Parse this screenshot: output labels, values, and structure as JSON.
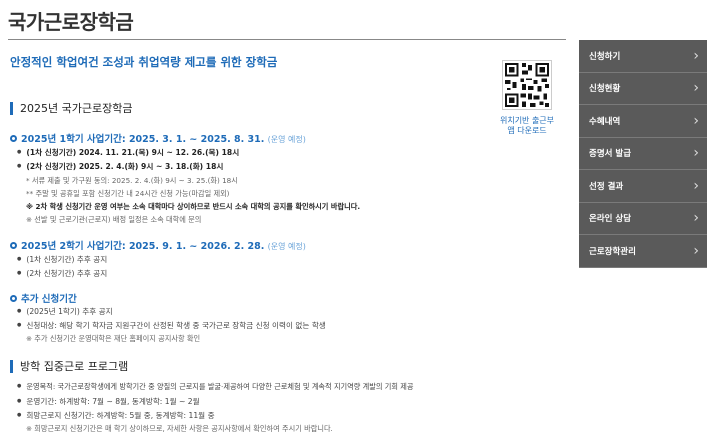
{
  "page": {
    "title": "국가근로장학금",
    "subtitle": "안정적인 학업여건 조성과 취업역량 제고를 위한 장학금"
  },
  "qr": {
    "label_line1": "위치기반 출근부",
    "label_line2": "앱 다운로드"
  },
  "section1": {
    "heading": "2025년 국가근로장학금",
    "period1": {
      "title": "2025년 1학기 사업기간: 2025. 3. 1. ~ 2025. 8. 31.",
      "note": "(운영 예정)",
      "lines": [
        "(1차 신청기간) 2024. 11. 21.(목) 9시 ~ 12. 26.(목) 18시",
        "(2차 신청기간) 2025. 2. 4.(화) 9시 ~ 3. 18.(화) 18시",
        "* 서류 제출 및 가구원 동의: 2025. 2. 4.(화) 9시 ~ 3. 25.(화) 18시",
        "** 주말 및 공휴일 포함 신청기간 내 24시간 신청 가능(마감일 제외)",
        "※ 2차 학생 신청기간 운영 여부는 소속 대학마다 상이하므로 반드시 소속 대학의 공지를 확인하시기 바랍니다.",
        "※ 선발 및 근로기관(근로지) 배정 일정은 소속 대학에 문의"
      ]
    },
    "period2": {
      "title": "2025년 2학기 사업기간: 2025. 9. 1. ~ 2026. 2. 28.",
      "note": "(운영 예정)",
      "lines": [
        "(1차 신청기간) 추후 공지",
        "(2차 신청기간) 추후 공지"
      ]
    },
    "extra": {
      "title": "추가 신청기간",
      "lines": [
        "(2025년 1학기) 추후 공지",
        "신청대상: 해당 학기 학자금 지원구간이 산정된 학생 중 국가근로 장학금 신청 이력이 없는 학생",
        "※ 추가 신청기간 운영대학은 재단 홈페이지 공지사항 확인"
      ]
    }
  },
  "section2": {
    "heading": "방학 집중근로 프로그램",
    "lines": [
      "운영목적: 국가근로장학생에게 방학기간 중 양질의 근로지를 발굴·제공하여 다양한 근로체험 및 계속적 지기역량 계발의 기회 제공",
      "운영기간: 하계방학: 7월 ~ 8월, 동계방학: 1월 ~ 2월",
      "희망근로지 신청기간: 하계방학: 5월 중, 동계방학: 11월 중",
      "※ 희망근로지 신청기간은 매 학기 상이하므로, 자세한 사항은 공지사항에서 확인하여 주시기 바랍니다."
    ]
  },
  "side_menu": [
    "신청하기",
    "신청현황",
    "수혜내역",
    "증명서 발급",
    "선정 결과",
    "온라인 상담",
    "근로장학관리"
  ],
  "colors": {
    "accent": "#1e6bb8",
    "menu_bg": "#5a5a5a"
  }
}
